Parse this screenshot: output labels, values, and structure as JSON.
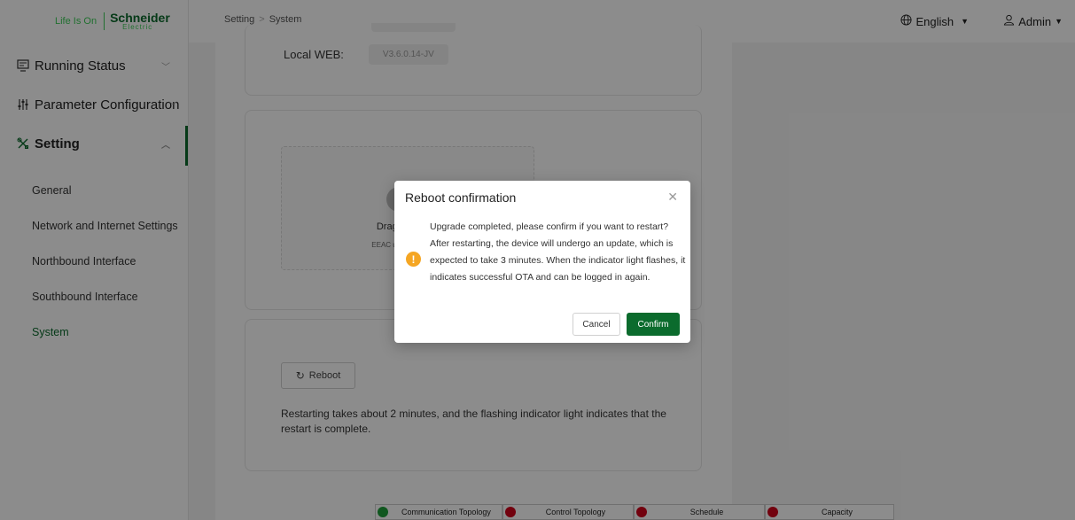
{
  "logo": {
    "tagline": "Life Is On",
    "brand": "Schneider",
    "brand_sub": "Electric"
  },
  "breadcrumb": {
    "parent": "Setting",
    "separator": ">",
    "current": "System"
  },
  "header": {
    "language": "English",
    "user": "Admin"
  },
  "sidebar": {
    "menus": [
      {
        "label": "Running Status",
        "icon": "monitor-icon",
        "expanded": false
      },
      {
        "label": "Parameter Configuration",
        "icon": "sliders-icon",
        "expanded": false
      },
      {
        "label": "Setting",
        "icon": "tools-icon",
        "expanded": true,
        "active": true
      }
    ],
    "sub_items": [
      {
        "label": "General"
      },
      {
        "label": "Network and Internet Settings"
      },
      {
        "label": "Northbound Interface"
      },
      {
        "label": "Southbound Interface"
      },
      {
        "label": "System",
        "selected": true
      }
    ]
  },
  "main": {
    "version": {
      "local_web_label": "Local WEB:",
      "local_web_value": "V3.6.0.14-JV"
    },
    "upload": {
      "drag_text": "Drag files or C",
      "hint_text": "EEAC upgrade packag"
    },
    "reboot": {
      "button_label": "Reboot",
      "description": "Restarting takes about 2 minutes, and the flashing indicator light indicates that the restart is complete."
    }
  },
  "statusbar": [
    {
      "label": "Communication Topology",
      "status": "ok",
      "color": "#1e9e3a"
    },
    {
      "label": "Control Topology",
      "status": "error",
      "color": "#d0021b"
    },
    {
      "label": "Schedule",
      "status": "error",
      "color": "#d0021b"
    },
    {
      "label": "Capacity",
      "status": "error",
      "color": "#d0021b"
    }
  ],
  "modal": {
    "title": "Reboot confirmation",
    "message": "Upgrade completed, please confirm if you want to restart? After restarting, the device will undergo an update, which is expected to take 3 minutes. When the indicator light flashes, it indicates successful OTA and can be logged in again.",
    "cancel_label": "Cancel",
    "confirm_label": "Confirm"
  },
  "colors": {
    "brand_green": "#0b6b2d",
    "accent_green": "#3dcd58",
    "warning": "#f5a623",
    "error": "#d0021b"
  }
}
